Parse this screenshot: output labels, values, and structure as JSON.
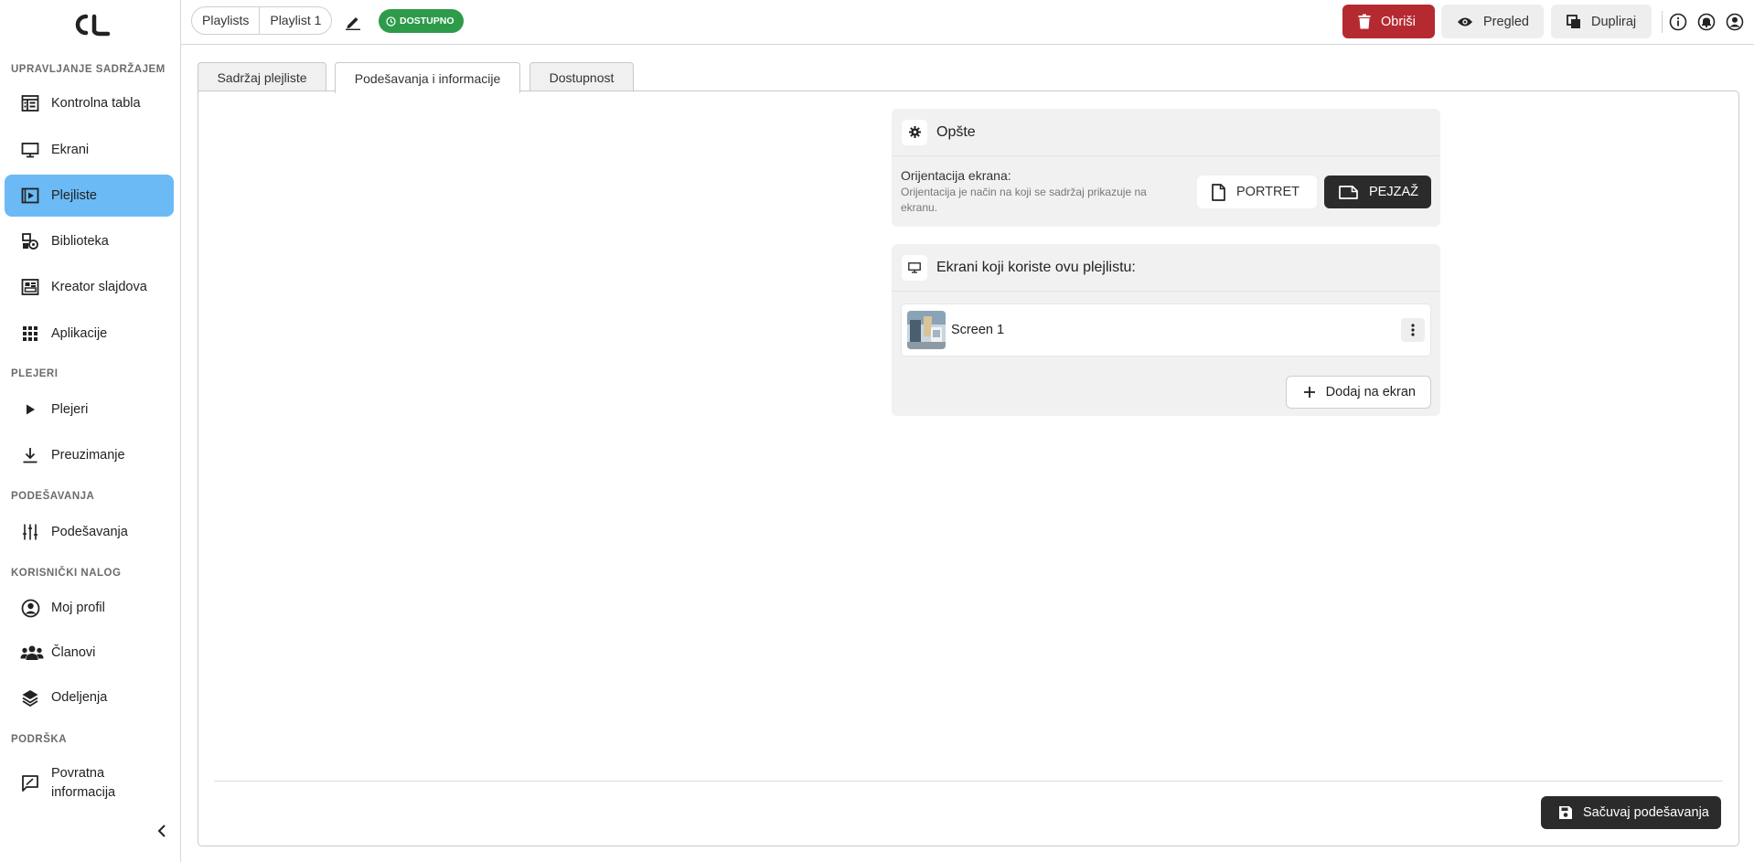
{
  "sidebar": {
    "sections": [
      {
        "label": "UPRAVLJANJE SADRŽAJEM"
      },
      {
        "label": "PLEJERI"
      },
      {
        "label": "PODEŠAVANJA"
      },
      {
        "label": "KORISNIČKI NALOG"
      },
      {
        "label": "PODRŠKA"
      }
    ],
    "items": [
      {
        "label": "Kontrolna tabla",
        "icon": "dashboard-icon"
      },
      {
        "label": "Ekrani",
        "icon": "monitor-icon"
      },
      {
        "label": "Plejliste",
        "icon": "playlist-icon",
        "active": true
      },
      {
        "label": "Biblioteka",
        "icon": "library-icon"
      },
      {
        "label": "Kreator slajdova",
        "icon": "slide-creator-icon"
      },
      {
        "label": "Aplikacije",
        "icon": "apps-grid-icon"
      },
      {
        "label": "Plejeri",
        "icon": "play-icon"
      },
      {
        "label": "Preuzimanje",
        "icon": "download-icon"
      },
      {
        "label": "Podešavanja",
        "icon": "sliders-icon"
      },
      {
        "label": "Moj profil",
        "icon": "user-circle-icon"
      },
      {
        "label": "Članovi",
        "icon": "members-icon"
      },
      {
        "label": "Odeljenja",
        "icon": "layers-icon"
      },
      {
        "label": "Povratna informacija",
        "icon": "feedback-icon"
      }
    ]
  },
  "topbar": {
    "breadcrumb": [
      "Playlists",
      "Playlist 1"
    ],
    "status": "DOSTUPNO",
    "delete_label": "Obriši",
    "preview_label": "Pregled",
    "duplicate_label": "Dupliraj"
  },
  "tabs": [
    "Sadržaj plejliste",
    "Podešavanja i informacije",
    "Dostupnost"
  ],
  "active_tab": "Podešavanja i informacije",
  "general": {
    "title": "Opšte",
    "orientation_label": "Orijentacija ekrana:",
    "orientation_desc": "Orijentacija je način na koji se sadržaj prikazuje na ekranu.",
    "portrait_label": "PORTRET",
    "landscape_label": "PEJZAŽ",
    "selected": "PEJZAŽ"
  },
  "screens": {
    "title": "Ekrani koji koriste ovu plejlistu:",
    "items": [
      {
        "name": "Screen 1"
      }
    ],
    "add_label": "Dodaj na ekran"
  },
  "save_label": "Sačuvaj podešavanja",
  "colors": {
    "active_nav": "#6bbaf5",
    "delete": "#b52a30",
    "status": "#2e9b4a",
    "dark_button": "#2b2b2b"
  }
}
